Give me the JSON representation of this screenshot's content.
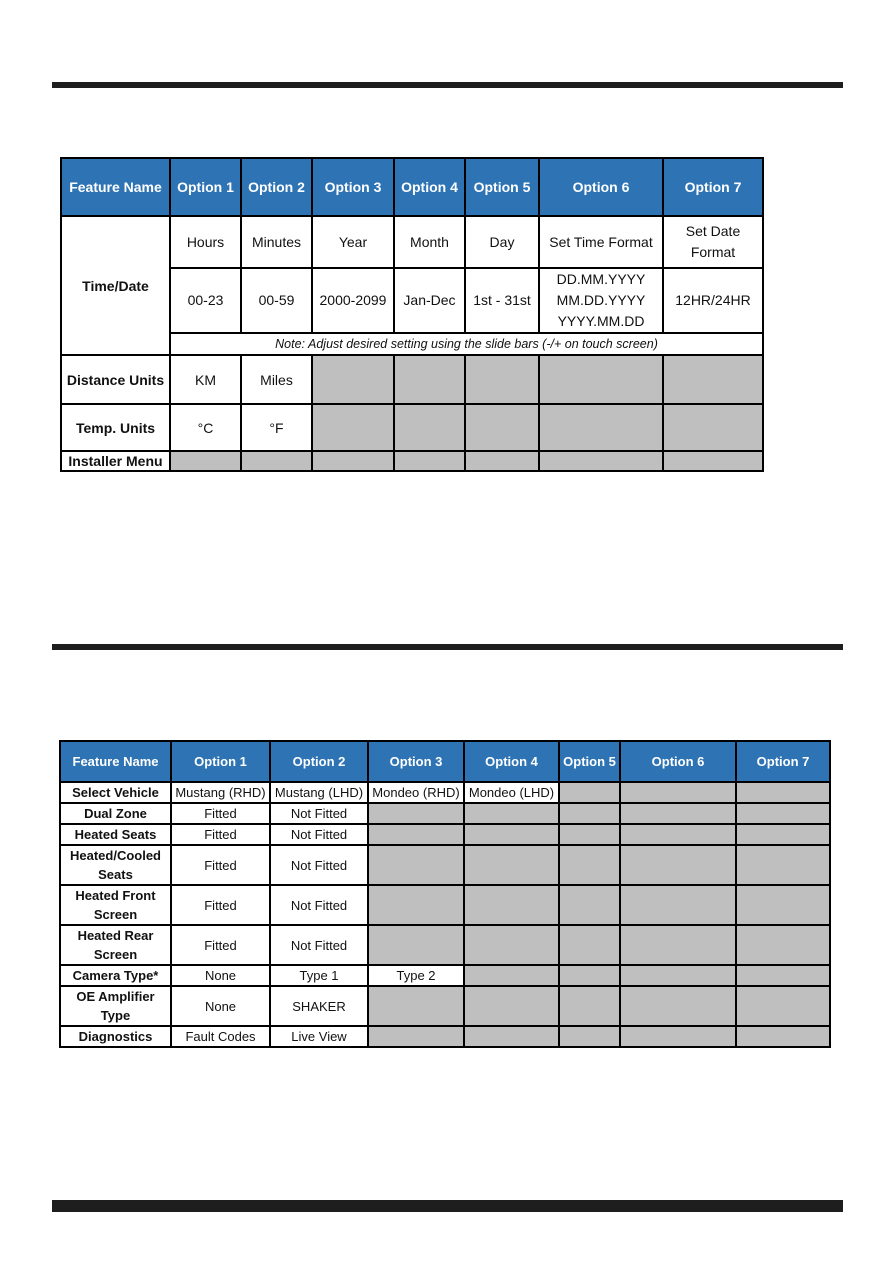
{
  "table1": {
    "headers": [
      "Feature Name",
      "Option 1",
      "Option 2",
      "Option 3",
      "Option 4",
      "Option 5",
      "Option 6",
      "Option 7"
    ],
    "time_date": {
      "feature": "Time/Date",
      "labels": [
        "Hours",
        "Minutes",
        "Year",
        "Month",
        "Day",
        "Set Time Format",
        "Set Date Format"
      ],
      "values": [
        "00-23",
        "00-59",
        "2000-2099",
        "Jan-Dec",
        "1st - 31st",
        "DD.MM.YYYY\nMM.DD.YYYY\nYYYY.MM.DD",
        "12HR/24HR"
      ],
      "note": "Note: Adjust desired setting using the slide bars (-/+ on touch screen)"
    },
    "distance_units": {
      "feature": "Distance Units",
      "options": [
        "KM",
        "Miles"
      ]
    },
    "temp_units": {
      "feature": "Temp. Units",
      "options": [
        "°C",
        "°F"
      ]
    },
    "installer_menu": {
      "feature": "Installer Menu",
      "options": []
    }
  },
  "table2": {
    "headers": [
      "Feature Name",
      "Option 1",
      "Option 2",
      "Option 3",
      "Option 4",
      "Option 5",
      "Option 6",
      "Option 7"
    ],
    "rows": [
      {
        "feature": "Select Vehicle",
        "options": [
          "Mustang (RHD)",
          "Mustang (LHD)",
          "Mondeo (RHD)",
          "Mondeo (LHD)"
        ],
        "tall": false
      },
      {
        "feature": "Dual Zone",
        "options": [
          "Fitted",
          "Not Fitted"
        ],
        "tall": false
      },
      {
        "feature": "Heated Seats",
        "options": [
          "Fitted",
          "Not Fitted"
        ],
        "tall": false
      },
      {
        "feature": "Heated/Cooled Seats",
        "options": [
          "Fitted",
          "Not Fitted"
        ],
        "tall": true
      },
      {
        "feature": "Heated Front Screen",
        "options": [
          "Fitted",
          "Not Fitted"
        ],
        "tall": true
      },
      {
        "feature": "Heated Rear Screen",
        "options": [
          "Fitted",
          "Not Fitted"
        ],
        "tall": true
      },
      {
        "feature": "Camera Type*",
        "options": [
          "None",
          "Type 1",
          "Type 2"
        ],
        "tall": false
      },
      {
        "feature": "OE Amplifier Type",
        "options": [
          "None",
          "SHAKER"
        ],
        "tall": true
      },
      {
        "feature": "Diagnostics",
        "options": [
          "Fault Codes",
          "Live View"
        ],
        "tall": false
      }
    ]
  }
}
